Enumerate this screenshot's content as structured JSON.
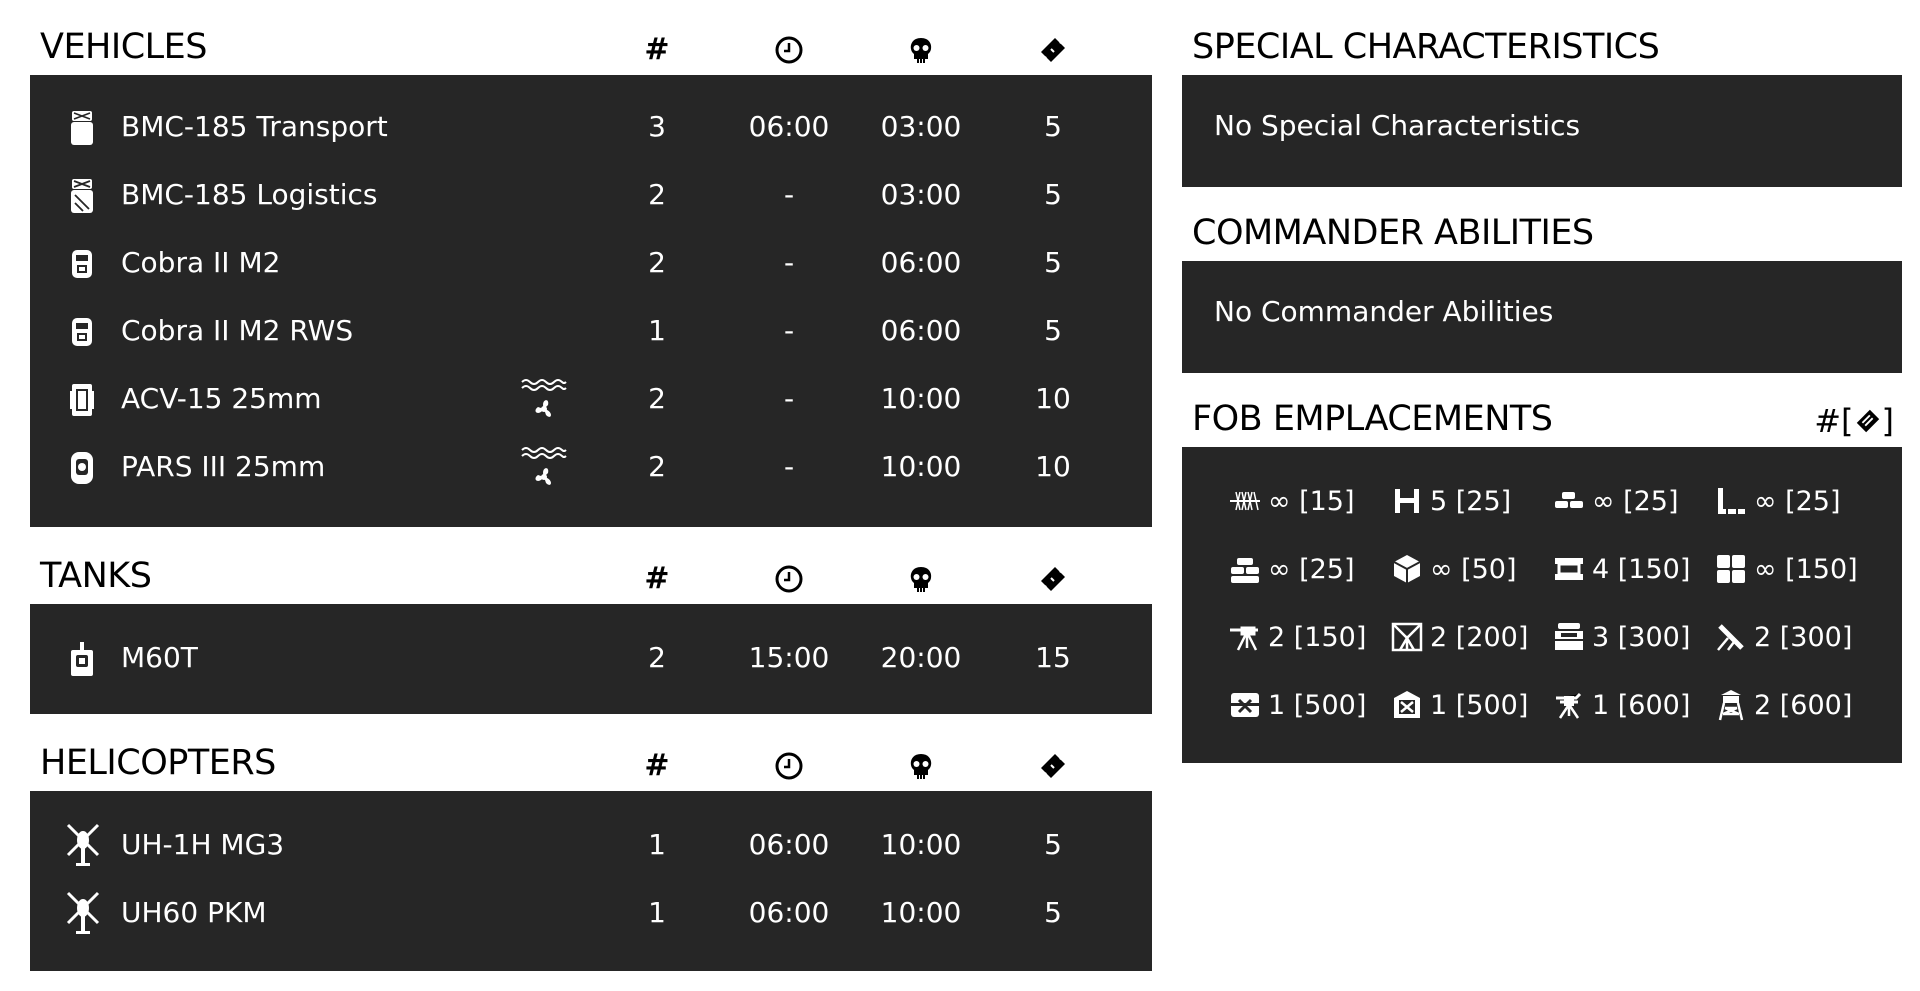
{
  "vehicles": {
    "title": "VEHICLES",
    "header_icons": {
      "count": "#",
      "respawn": "clock-icon",
      "delay": "skull-icon",
      "tickets": "ticket-icon"
    },
    "rows": [
      {
        "name": "BMC-185 Transport",
        "icon": "truck-transport-icon",
        "amphibious": false,
        "count": "3",
        "respawn": "06:00",
        "delay": "03:00",
        "tickets": "5"
      },
      {
        "name": "BMC-185 Logistics",
        "icon": "truck-logistics-icon",
        "amphibious": false,
        "count": "2",
        "respawn": "-",
        "delay": "03:00",
        "tickets": "5"
      },
      {
        "name": "Cobra II M2",
        "icon": "jeep-icon",
        "amphibious": false,
        "count": "2",
        "respawn": "-",
        "delay": "06:00",
        "tickets": "5"
      },
      {
        "name": "Cobra II M2 RWS",
        "icon": "jeep-icon",
        "amphibious": false,
        "count": "1",
        "respawn": "-",
        "delay": "06:00",
        "tickets": "5"
      },
      {
        "name": "ACV-15 25mm",
        "icon": "ifv-icon",
        "amphibious": true,
        "count": "2",
        "respawn": "-",
        "delay": "10:00",
        "tickets": "10"
      },
      {
        "name": "PARS III 25mm",
        "icon": "apc-icon",
        "amphibious": true,
        "count": "2",
        "respawn": "-",
        "delay": "10:00",
        "tickets": "10"
      }
    ]
  },
  "tanks": {
    "title": "TANKS",
    "header_icons": {
      "count": "#",
      "respawn": "clock-icon",
      "delay": "skull-icon",
      "tickets": "ticket-icon"
    },
    "rows": [
      {
        "name": "M60T",
        "icon": "tank-icon",
        "count": "2",
        "respawn": "15:00",
        "delay": "20:00",
        "tickets": "15"
      }
    ]
  },
  "helicopters": {
    "title": "HELICOPTERS",
    "header_icons": {
      "count": "#",
      "respawn": "clock-icon",
      "delay": "skull-icon",
      "tickets": "ticket-icon"
    },
    "rows": [
      {
        "name": "UH-1H MG3",
        "icon": "helicopter-icon",
        "count": "1",
        "respawn": "06:00",
        "delay": "10:00",
        "tickets": "5"
      },
      {
        "name": "UH60 PKM",
        "icon": "helicopter-icon",
        "count": "1",
        "respawn": "06:00",
        "delay": "10:00",
        "tickets": "5"
      }
    ]
  },
  "special": {
    "title": "SPECIAL CHARACTERISTICS",
    "text": "No Special Characteristics"
  },
  "commander": {
    "title": "COMMANDER ABILITIES",
    "text": "No Commander Abilities"
  },
  "fob": {
    "title": "FOB EMPLACEMENTS",
    "header_label": "#[",
    "header_end": "]",
    "header_icon": "construction-points-icon",
    "items": [
      {
        "icon": "razorwire-icon",
        "text": "∞ [15]"
      },
      {
        "icon": "tank-trap-icon",
        "text": "5 [25]"
      },
      {
        "icon": "sandbag-wall-icon",
        "text": "∞ [25]"
      },
      {
        "icon": "sandbag-corner-icon",
        "text": "∞ [25]"
      },
      {
        "icon": "sandbag-bunker-icon",
        "text": "∞ [25]"
      },
      {
        "icon": "ammo-crate-icon",
        "text": "∞ [50]"
      },
      {
        "icon": "barrier-icon",
        "text": "4 [150]"
      },
      {
        "icon": "hesco-icon",
        "text": "∞ [150]"
      },
      {
        "icon": "hmg-emplacement-icon",
        "text": "2 [150]"
      },
      {
        "icon": "tow-emplacement-icon",
        "text": "2 [200]"
      },
      {
        "icon": "bunker-icon",
        "text": "3 [300]"
      },
      {
        "icon": "mortar-icon",
        "text": "2 [300]"
      },
      {
        "icon": "firebase-icon",
        "text": "1 [500]"
      },
      {
        "icon": "repair-station-icon",
        "text": "1 [500]"
      },
      {
        "icon": "aa-emplacement-icon",
        "text": "1 [600]"
      },
      {
        "icon": "watchtower-icon",
        "text": "2 [600]"
      }
    ]
  }
}
